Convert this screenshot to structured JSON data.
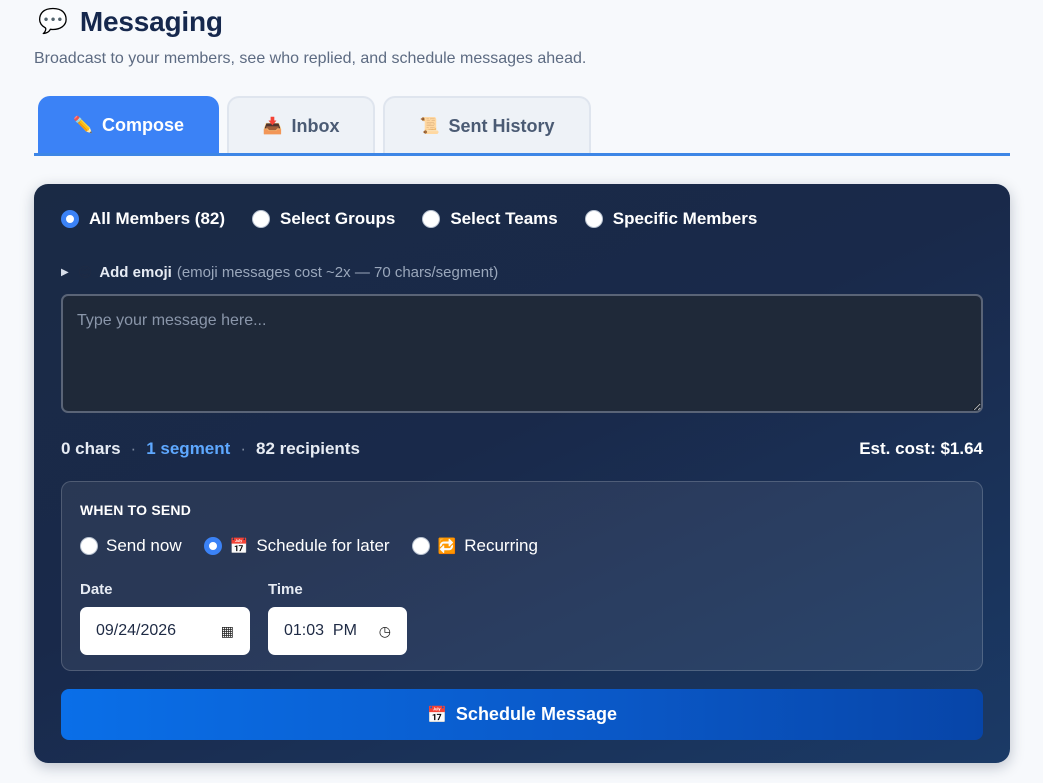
{
  "header": {
    "icon": "speech-bubble-icon",
    "title": "Messaging",
    "subtitle": "Broadcast to your members, see who replied, and schedule messages ahead."
  },
  "tabs": [
    {
      "icon": "pencil-icon",
      "label": "Compose",
      "active": true
    },
    {
      "icon": "inbox-tray-icon",
      "label": "Inbox",
      "active": false
    },
    {
      "icon": "scroll-icon",
      "label": "Sent History",
      "active": false
    }
  ],
  "audience": {
    "options": [
      {
        "label": "All Members (82)",
        "selected": true
      },
      {
        "label": "Select Groups",
        "selected": false
      },
      {
        "label": "Select Teams",
        "selected": false
      },
      {
        "label": "Specific Members",
        "selected": false
      }
    ]
  },
  "emoji": {
    "label": "Add emoji",
    "note": "(emoji messages cost ~2x — 70 chars/segment)"
  },
  "message": {
    "value": "",
    "placeholder": "Type your message here..."
  },
  "stats": {
    "chars": "0 chars",
    "segments": "1 segment",
    "recipients": "82 recipients",
    "separator": "·",
    "cost": "Est. cost: $1.64"
  },
  "when": {
    "title": "WHEN TO SEND",
    "options": [
      {
        "label": "Send now",
        "selected": false,
        "icon": ""
      },
      {
        "label": "Schedule for later",
        "selected": true,
        "icon": "calendar-icon"
      },
      {
        "label": "Recurring",
        "selected": false,
        "icon": "repeat-icon"
      }
    ],
    "date_label": "Date",
    "date_value": "09/24/2026",
    "time_label": "Time",
    "time_value": "01:03  PM"
  },
  "cta": {
    "icon": "calendar-icon",
    "label": "Schedule Message"
  },
  "colors": {
    "accent": "#3b82f6",
    "card_bg": "#1a2a45",
    "segment_link": "#5ea8ff",
    "title": "#16284d"
  }
}
